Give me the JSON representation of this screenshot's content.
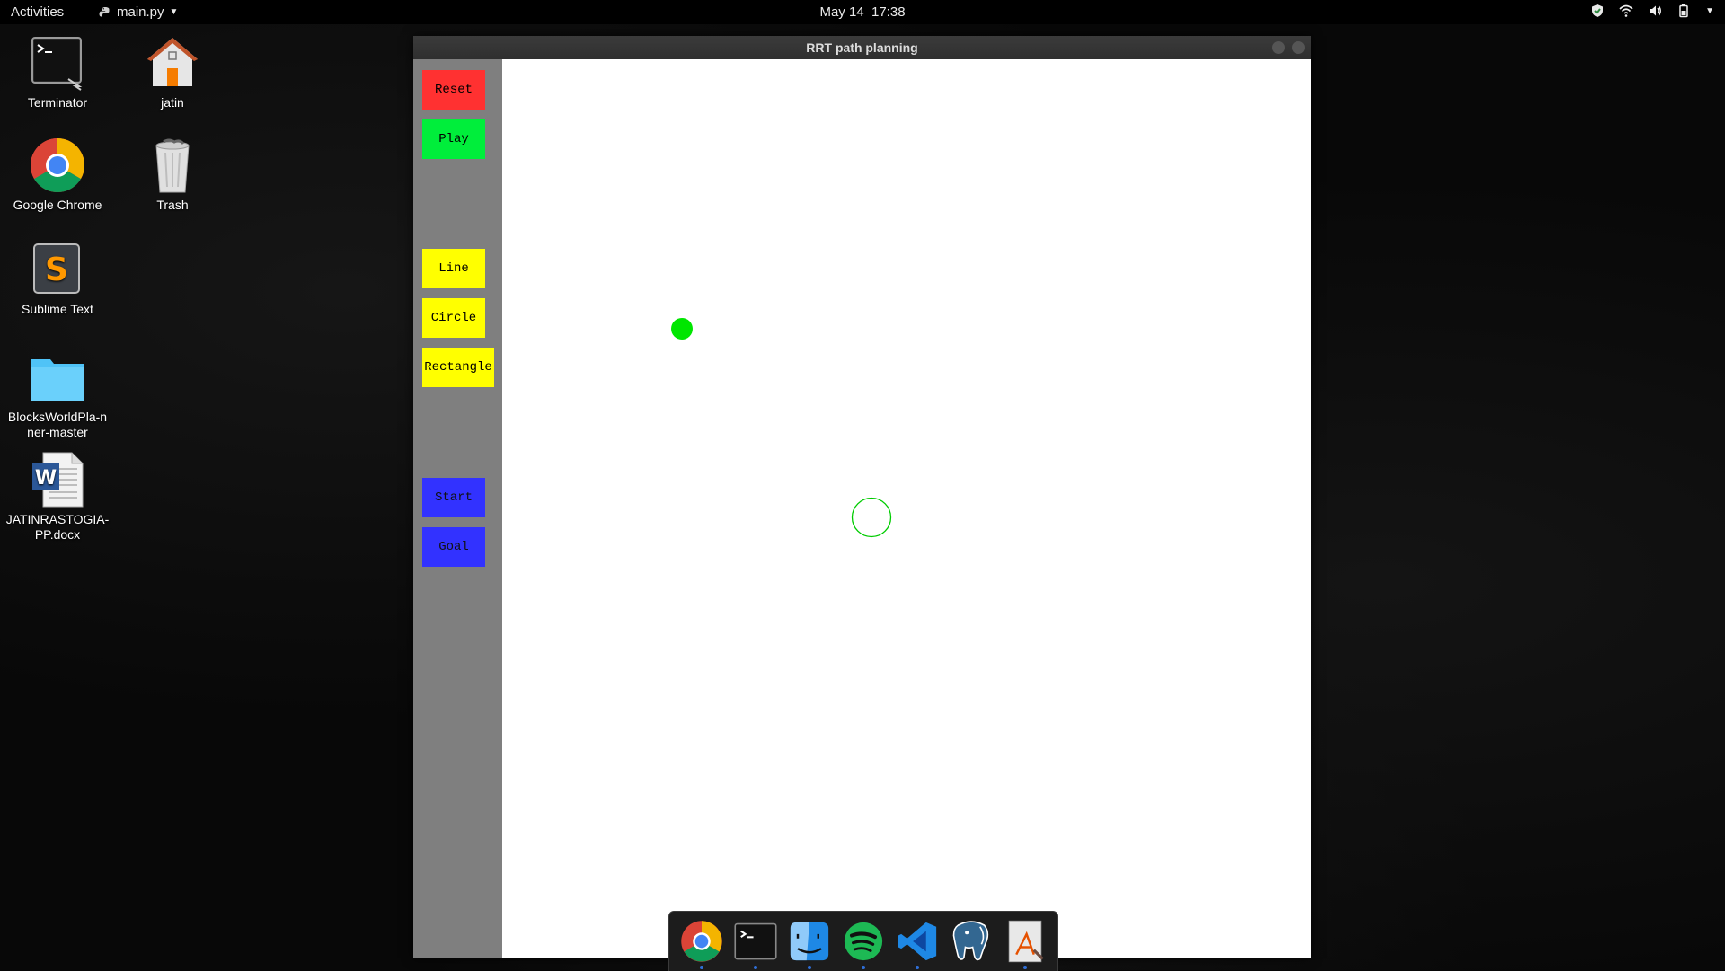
{
  "topbar": {
    "activities": "Activities",
    "app_menu": "main.py",
    "date": "May 14",
    "time": "17:38",
    "tray_icons": [
      "shield-icon",
      "wifi-icon",
      "volume-icon",
      "battery-icon",
      "chevron-down-icon"
    ]
  },
  "desktop_icons": [
    {
      "label": "Terminator",
      "icon": "terminal-icon"
    },
    {
      "label": "jatin",
      "icon": "home-folder-icon"
    },
    {
      "label": "Google Chrome",
      "icon": "chrome-icon"
    },
    {
      "label": "Trash",
      "icon": "trash-icon"
    },
    {
      "label": "Sublime Text",
      "icon": "sublime-icon"
    },
    {
      "label": "BlocksWorldPla-nner-master",
      "icon": "folder-icon"
    },
    {
      "label": "JATINRASTOGIA-PP.docx",
      "icon": "word-doc-icon"
    }
  ],
  "window": {
    "title": "RRT path planning",
    "buttons": {
      "reset": "Reset",
      "play": "Play",
      "line": "Line",
      "circle": "Circle",
      "rectangle": "Rectangle",
      "start": "Start",
      "goal": "Goal"
    },
    "colors": {
      "reset": "#ff3131",
      "play": "#00ee3b",
      "shape_tools": "#ffff00",
      "start_goal": "#3232ff",
      "panel": "#7f7f7f",
      "start_marker": "#00e600",
      "goal_marker": "#00cc00"
    }
  },
  "dock_apps": [
    "chrome-icon",
    "terminal-icon",
    "finder-icon",
    "spotify-icon",
    "vscode-icon",
    "postgres-icon",
    "text-editor-icon"
  ]
}
